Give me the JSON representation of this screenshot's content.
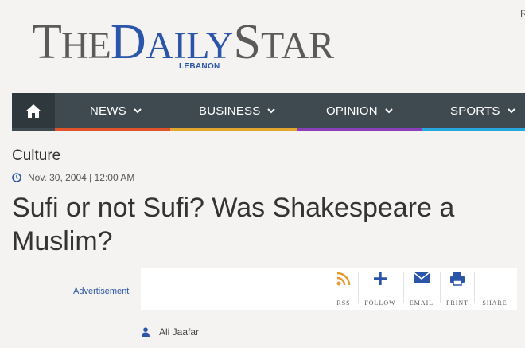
{
  "header": {
    "logo_part1_big": "T",
    "logo_part1_rest": "HE",
    "logo_part2_big": "D",
    "logo_part2_rest": "AILY",
    "logo_part3_big": "S",
    "logo_part3_rest": "TAR",
    "logo_sub": "LEBANON",
    "corner_letter": "R"
  },
  "nav": {
    "home_icon": "home-icon",
    "items": [
      {
        "label": "NEWS",
        "strip": "#e0522a"
      },
      {
        "label": "BUSINESS",
        "strip": "#e1a62b"
      },
      {
        "label": "OPINION",
        "strip": "#8a3fb8"
      },
      {
        "label": "SPORTS",
        "strip": "#26a7dd"
      }
    ]
  },
  "article": {
    "section": "Culture",
    "date": "Nov. 30, 2004 | 12:00 AM",
    "headline": "Sufi or not Sufi? Was Shakespeare a Muslim?",
    "ad_label": "Advertisement",
    "author": "Ali Jaafar"
  },
  "share": {
    "items": [
      {
        "label": "RSS",
        "icon": "rss-icon",
        "color": "#e69a2e"
      },
      {
        "label": "FOLLOW",
        "icon": "plus-icon",
        "color": "#2b55a8"
      },
      {
        "label": "EMAIL",
        "icon": "email-icon",
        "color": "#2b55a8"
      },
      {
        "label": "PRINT",
        "icon": "print-icon",
        "color": "#2b55a8"
      },
      {
        "label": "SHARE",
        "icon": "share-icon",
        "color": "#2b55a8"
      }
    ]
  },
  "colors": {
    "nav_bg": "#3f4a50",
    "nav_home_bg": "#2f383d",
    "accent_blue": "#2b55a8",
    "logo_gray": "#5b5a58"
  }
}
